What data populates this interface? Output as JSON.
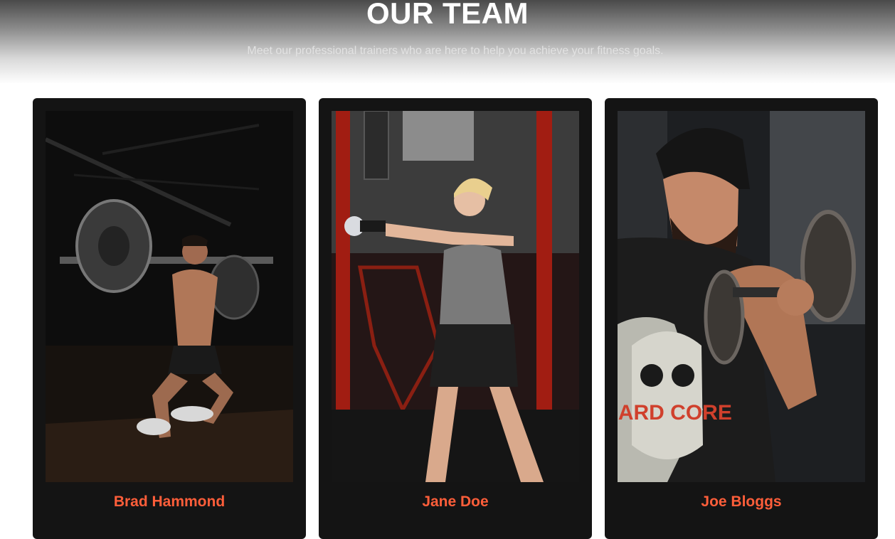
{
  "header": {
    "title": "OUR TEAM",
    "subtitle": "Meet our professional trainers who are here to help you achieve your fitness goals."
  },
  "team": [
    {
      "name": "Brad Hammond",
      "photo": "man-barbell-squat-photo"
    },
    {
      "name": "Jane Doe",
      "photo": "woman-kettlebell-photo"
    },
    {
      "name": "Joe Bloggs",
      "photo": "man-dumbbell-curl-photo"
    }
  ],
  "shirt_print": "HARD CORE",
  "colors": {
    "accent": "#ff5e3a",
    "card": "#141414",
    "title": "#ffffff"
  }
}
